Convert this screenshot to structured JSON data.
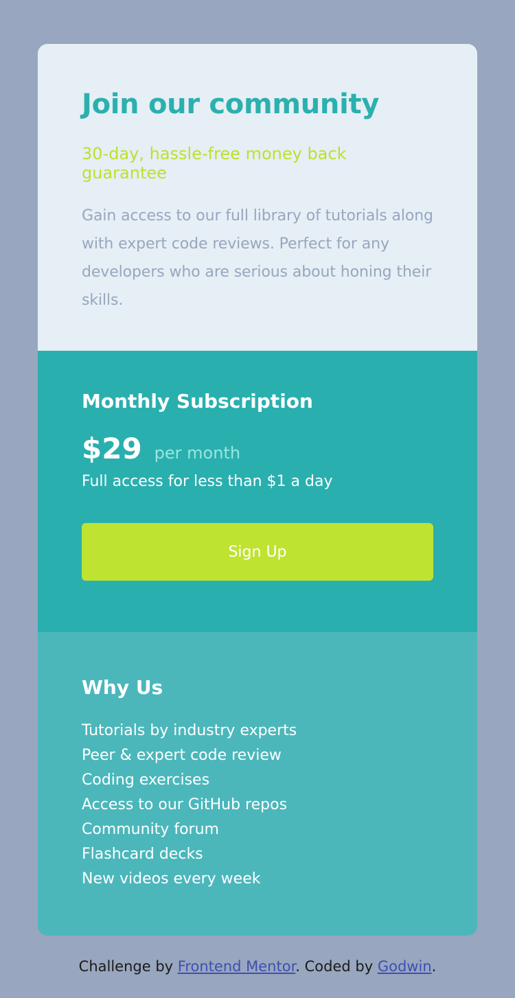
{
  "top": {
    "title": "Join our community",
    "subtitle": "30-day, hassle-free money back guarantee",
    "description": "Gain access to our full library of tutorials along with expert code reviews. Perfect for any developers who are serious about honing their skills."
  },
  "subscription": {
    "title": "Monthly Subscription",
    "price": "$29",
    "period": "per month",
    "access": "Full access for less than $1 a day",
    "button_label": "Sign Up"
  },
  "why": {
    "title": "Why Us",
    "items": [
      "Tutorials by industry experts",
      "Peer & expert code review",
      "Coding exercises",
      "Access to our GitHub repos",
      "Community forum",
      "Flashcard decks",
      "New videos every week"
    ]
  },
  "footer": {
    "prefix": "Challenge by",
    "link1": "Frontend Mentor",
    "middle": ". Coded by",
    "link2": "Godwin",
    "suffix": "."
  },
  "colors": {
    "background": "#98a6bf",
    "top_bg": "#e5eff5",
    "accent_teal": "#2bb0ae",
    "lime": "#bfdf2e",
    "middle_bg": "#2aafaf",
    "bottom_bg": "#4bb7bb"
  }
}
